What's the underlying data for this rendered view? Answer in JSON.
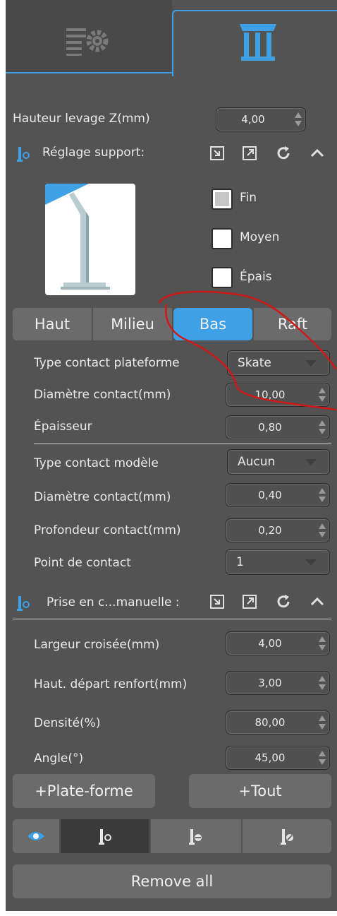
{
  "z_lift": {
    "label": "Hauteur levage Z(mm)",
    "value": "4,00"
  },
  "support_section": {
    "title": "Réglage support:"
  },
  "density_options": [
    {
      "label": "Fin",
      "checked": false
    },
    {
      "label": "Moyen",
      "checked": false
    },
    {
      "label": "Épais",
      "checked": false
    }
  ],
  "segments": [
    {
      "label": "Haut",
      "active": false
    },
    {
      "label": "Milieu",
      "active": false
    },
    {
      "label": "Bas",
      "active": true
    },
    {
      "label": "Raft",
      "active": false
    }
  ],
  "bottom_settings": {
    "platform_contact_type": {
      "label": "Type contact plateforme",
      "value": "Skate"
    },
    "contact_diameter": {
      "label": "Diamètre contact(mm)",
      "value": "10,00"
    },
    "thickness": {
      "label": "Épaisseur",
      "value": "0,80"
    },
    "model_contact_type": {
      "label": "Type contact modèle",
      "value": "Aucun"
    },
    "model_contact_diameter": {
      "label": "Diamètre contact(mm)",
      "value": "0,40"
    },
    "contact_depth": {
      "label": "Profondeur contact(mm)",
      "value": "0,20"
    },
    "contact_point": {
      "label": "Point de contact",
      "value": "1"
    }
  },
  "manual_section": {
    "title": "Prise en c...manuelle :"
  },
  "manual_settings": {
    "cross_width": {
      "label": "Largeur croisée(mm)",
      "value": "4,00"
    },
    "brace_start": {
      "label": "Haut. départ renfort(mm)",
      "value": "3,00"
    },
    "density": {
      "label": "Densité(%)",
      "value": "80,00"
    },
    "angle": {
      "label": "Angle(°)",
      "value": "45,00"
    }
  },
  "buttons": {
    "platform": "+Plate-forme",
    "all": "+Tout",
    "remove_all": "Remove all"
  },
  "icons": {
    "tab1": "sliders-gear-icon",
    "tab2": "support-columns-icon",
    "import": "import-icon",
    "export": "export-icon",
    "refresh": "refresh-icon",
    "collapse": "chevron-up-icon",
    "eye": "eye-icon"
  },
  "colors": {
    "panel": "#535353",
    "accent": "#3ea1e6",
    "button": "#6b6b6b",
    "annotation": "#d01818"
  }
}
